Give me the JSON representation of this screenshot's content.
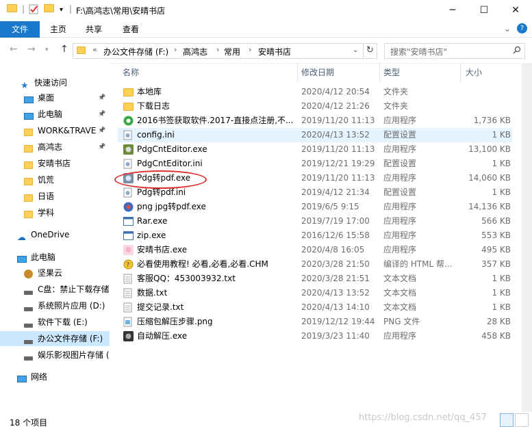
{
  "title_bar": {
    "path": "F:\\高鸿志\\常用\\安晴书店",
    "minimize": "─",
    "maximize": "☐",
    "close": "✕"
  },
  "ribbon": {
    "tabs": [
      "文件",
      "主页",
      "共享",
      "查看"
    ],
    "expand": "⌄",
    "help": "?"
  },
  "address": {
    "breadcrumb": [
      "办公文件存储 (F:)",
      "高鸿志",
      "常用",
      "安晴书店"
    ],
    "overflow": "«"
  },
  "search": {
    "placeholder": "搜索\"安晴书店\""
  },
  "nav_pane": [
    {
      "label": "快速访问",
      "kind": "star"
    },
    {
      "label": "桌面",
      "kind": "desktop"
    },
    {
      "label": "此电脑",
      "kind": "pc"
    },
    {
      "label": "WORK&TRAVE",
      "kind": "folder"
    },
    {
      "label": "高鸿志",
      "kind": "folder"
    },
    {
      "label": "安晴书店",
      "kind": "folder"
    },
    {
      "label": "饥荒",
      "kind": "folder"
    },
    {
      "label": "日语",
      "kind": "folder"
    },
    {
      "label": "学科",
      "kind": "folder"
    },
    {
      "label": "OneDrive",
      "kind": "cloud"
    },
    {
      "label": "此电脑",
      "kind": "pc"
    },
    {
      "label": "坚果云",
      "kind": "nut"
    },
    {
      "label": "C盘：禁止下载存储",
      "kind": "drive"
    },
    {
      "label": "系统照片应用 (D:)",
      "kind": "drive"
    },
    {
      "label": "软件下载 (E:)",
      "kind": "drive"
    },
    {
      "label": "办公文件存储 (F:)",
      "kind": "drive"
    },
    {
      "label": "娱乐影视图片存储 (",
      "kind": "drive"
    },
    {
      "label": "网络",
      "kind": "network"
    }
  ],
  "columns": {
    "name": "名称",
    "date": "修改日期",
    "type": "类型",
    "size": "大小"
  },
  "files": [
    {
      "name": "本地库",
      "date": "2020/4/12 20:54",
      "type": "文件夹",
      "size": "",
      "icon": "folder"
    },
    {
      "name": "下载日志",
      "date": "2020/4/12 21:26",
      "type": "文件夹",
      "size": "",
      "icon": "folder"
    },
    {
      "name": "2016书签获取软件.2017-直接点注册,不...",
      "date": "2019/11/20 11:13",
      "type": "应用程序",
      "size": "1,736 KB",
      "icon": "green-app"
    },
    {
      "name": "config.ini",
      "date": "2020/4/13 13:52",
      "type": "配置设置",
      "size": "1 KB",
      "icon": "ini"
    },
    {
      "name": "PdgCntEditor.exe",
      "date": "2019/11/20 11:13",
      "type": "应用程序",
      "size": "13,100 KB",
      "icon": "gear-app"
    },
    {
      "name": "PdgCntEditor.ini",
      "date": "2019/12/21 19:29",
      "type": "配置设置",
      "size": "1 KB",
      "icon": "ini"
    },
    {
      "name": "Pdg转pdf.exe",
      "date": "2019/11/20 11:13",
      "type": "应用程序",
      "size": "14,060 KB",
      "icon": "pdg-app"
    },
    {
      "name": "Pdg转pdf.ini",
      "date": "2019/4/12 21:34",
      "type": "配置设置",
      "size": "1 KB",
      "icon": "ini"
    },
    {
      "name": "png jpg转pdf.exe",
      "date": "2019/6/5 9:15",
      "type": "应用程序",
      "size": "14,136 KB",
      "icon": "png-app"
    },
    {
      "name": "Rar.exe",
      "date": "2019/7/19 17:00",
      "type": "应用程序",
      "size": "566 KB",
      "icon": "window-app"
    },
    {
      "name": "zip.exe",
      "date": "2016/12/6 15:58",
      "type": "应用程序",
      "size": "553 KB",
      "icon": "window-app"
    },
    {
      "name": "安晴书店.exe",
      "date": "2020/4/8 16:05",
      "type": "应用程序",
      "size": "495 KB",
      "icon": "anime-app"
    },
    {
      "name": "必看使用教程! 必看,必看,必看.CHM",
      "date": "2020/3/28 21:50",
      "type": "编译的 HTML 帮...",
      "size": "357 KB",
      "icon": "chm"
    },
    {
      "name": "客服QQ：453003932.txt",
      "date": "2020/3/28 21:51",
      "type": "文本文档",
      "size": "1 KB",
      "icon": "txt"
    },
    {
      "name": "数据.txt",
      "date": "2020/4/13 13:52",
      "type": "文本文档",
      "size": "1 KB",
      "icon": "txt"
    },
    {
      "name": "提交记录.txt",
      "date": "2020/4/13 14:10",
      "type": "文本文档",
      "size": "1 KB",
      "icon": "txt"
    },
    {
      "name": "压缩包解压步骤.png",
      "date": "2019/12/12 19:44",
      "type": "PNG 文件",
      "size": "28 KB",
      "icon": "png"
    },
    {
      "name": "自动解压.exe",
      "date": "2019/3/23 11:40",
      "type": "应用程序",
      "size": "458 KB",
      "icon": "dark-app"
    }
  ],
  "status": {
    "count": "18 个项目"
  },
  "watermark": "https://blog.csdn.net/qq_457"
}
